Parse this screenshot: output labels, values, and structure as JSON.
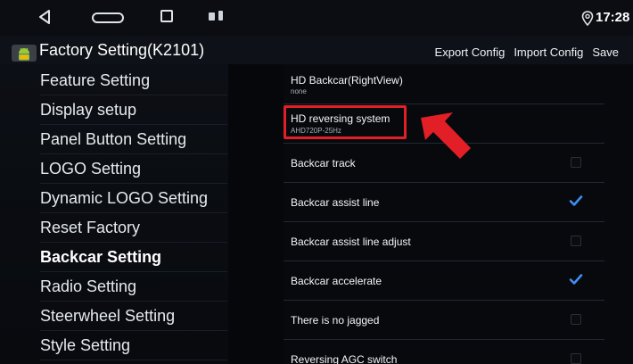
{
  "status_bar": {
    "time": "17:28",
    "icons": [
      "back-icon",
      "home-icon",
      "recent-apps-icon",
      "notification-icon",
      "battery-icon",
      "location-icon"
    ]
  },
  "title_bar": {
    "app_title": "Factory Setting(K2101)",
    "actions": {
      "export": "Export Config",
      "import": "Import Config",
      "save": "Save"
    },
    "app_icon": "android-icon"
  },
  "menu": {
    "items": [
      {
        "label": "Feature Setting",
        "active": false
      },
      {
        "label": "Display setup",
        "active": false
      },
      {
        "label": "Panel Button Setting",
        "active": false
      },
      {
        "label": "LOGO Setting",
        "active": false
      },
      {
        "label": "Dynamic LOGO Setting",
        "active": false
      },
      {
        "label": "Reset Factory",
        "active": false
      },
      {
        "label": "Backcar Setting",
        "active": true
      },
      {
        "label": "Radio Setting",
        "active": false
      },
      {
        "label": "Steerwheel Setting",
        "active": false
      },
      {
        "label": "Style Setting",
        "active": false
      }
    ]
  },
  "settings": {
    "rows": [
      {
        "title": "HD Backcar(RightView)",
        "subtitle": "none",
        "checkbox": null
      },
      {
        "title": "HD reversing system",
        "subtitle": "AHD720P-25Hz",
        "checkbox": null
      },
      {
        "title": "Backcar track",
        "subtitle": "",
        "checkbox": false
      },
      {
        "title": "Backcar assist line",
        "subtitle": "",
        "checkbox": true
      },
      {
        "title": "Backcar assist line adjust",
        "subtitle": "",
        "checkbox": false
      },
      {
        "title": "Backcar accelerate",
        "subtitle": "",
        "checkbox": true
      },
      {
        "title": "There is no jagged",
        "subtitle": "",
        "checkbox": false
      },
      {
        "title": "Reversing AGC switch",
        "subtitle": "",
        "checkbox": false
      }
    ]
  },
  "colors": {
    "highlight": "#e21f26",
    "check": "#3f8ff2",
    "background": "#05070b"
  }
}
